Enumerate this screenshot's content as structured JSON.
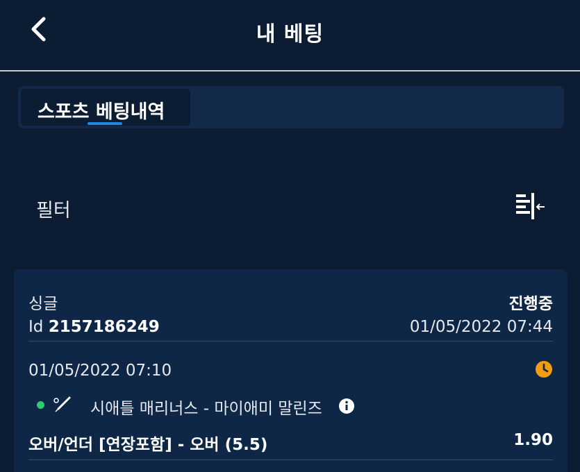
{
  "header": {
    "title": "내 베팅",
    "back_icon": "chevron-left-icon"
  },
  "tabs": [
    {
      "label": "스포츠 베팅내역",
      "active": true
    }
  ],
  "filter": {
    "label": "필터",
    "icon": "collapse-filter-icon"
  },
  "bet": {
    "type": "싱글",
    "status": "진행중",
    "id_prefix": "Id",
    "id": "2157186249",
    "placed_at": "01/05/2022 07:44",
    "event_time": "01/05/2022 07:10",
    "match": "시애틀 매리너스 - 마이애미 말린즈",
    "market": "오버/언더 [연장포함] - 오버 (5.5)",
    "odds": "1.90",
    "status_icon": "clock-icon",
    "sport_icon": "baseball-icon",
    "colors": {
      "live_dot": "#2ecc71",
      "clock": "#f39c12",
      "tab_underline": "#1e88e5"
    }
  }
}
